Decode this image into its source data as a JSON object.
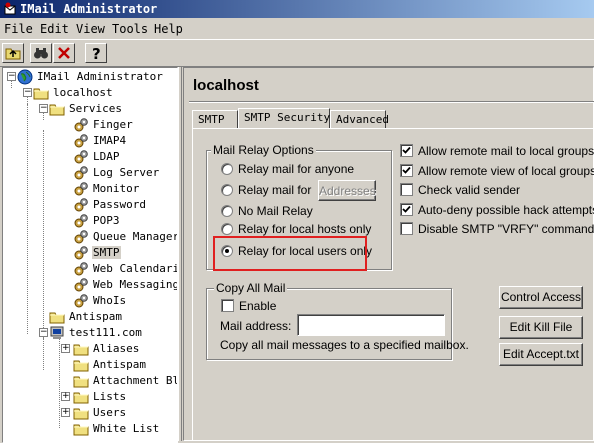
{
  "window": {
    "title": "IMail Administrator"
  },
  "menu": {
    "file": "File",
    "edit": "Edit",
    "view": "View",
    "tools": "Tools",
    "help": "Help"
  },
  "toolbar": {
    "icons": [
      "up-folder-icon",
      "find-icon",
      "delete-icon",
      "help-icon"
    ]
  },
  "tree": {
    "root": "IMail Administrator",
    "localhost": "localhost",
    "services": "Services",
    "service_items": [
      "Finger",
      "IMAP4",
      "LDAP",
      "Log Server",
      "Monitor",
      "Password",
      "POP3",
      "Queue Manager",
      "SMTP",
      "Web Calendari",
      "Web Messaging",
      "WhoIs"
    ],
    "antispam": "Antispam",
    "domain": "test111.com",
    "domain_items": [
      "Aliases",
      "Antispam",
      "Attachment Bl",
      "Lists",
      "Users",
      "White List"
    ],
    "selected": "SMTP"
  },
  "panel": {
    "title": "localhost",
    "tabs": [
      "SMTP",
      "SMTP Security",
      "Advanced"
    ],
    "active_tab": "SMTP Security"
  },
  "relay": {
    "group_label": "Mail Relay Options",
    "options": [
      "Relay mail for anyone",
      "Relay mail for",
      "No Mail Relay",
      "Relay for local hosts only",
      "Relay for local users only"
    ],
    "selected": "Relay for local users only",
    "addresses_button": "Addresses"
  },
  "checks": {
    "items": [
      {
        "label": "Allow remote mail to local groups",
        "checked": true
      },
      {
        "label": "Allow remote view of local groups",
        "checked": true
      },
      {
        "label": "Check valid sender",
        "checked": false
      },
      {
        "label": "Auto-deny possible hack attempts",
        "checked": true
      },
      {
        "label": "Disable SMTP \"VRFY\" command",
        "checked": false
      }
    ]
  },
  "copy_all": {
    "group_label": "Copy All Mail",
    "enable_label": "Enable",
    "enabled": false,
    "address_label": "Mail address:",
    "address_value": "",
    "description": "Copy all mail messages to a specified mailbox."
  },
  "buttons": {
    "control_access": "Control Access",
    "edit_kill_file": "Edit Kill File",
    "edit_accept": "Edit Accept.txt"
  },
  "colors": {
    "highlight_box": "#e02020",
    "title_bar": "#0a246a"
  }
}
